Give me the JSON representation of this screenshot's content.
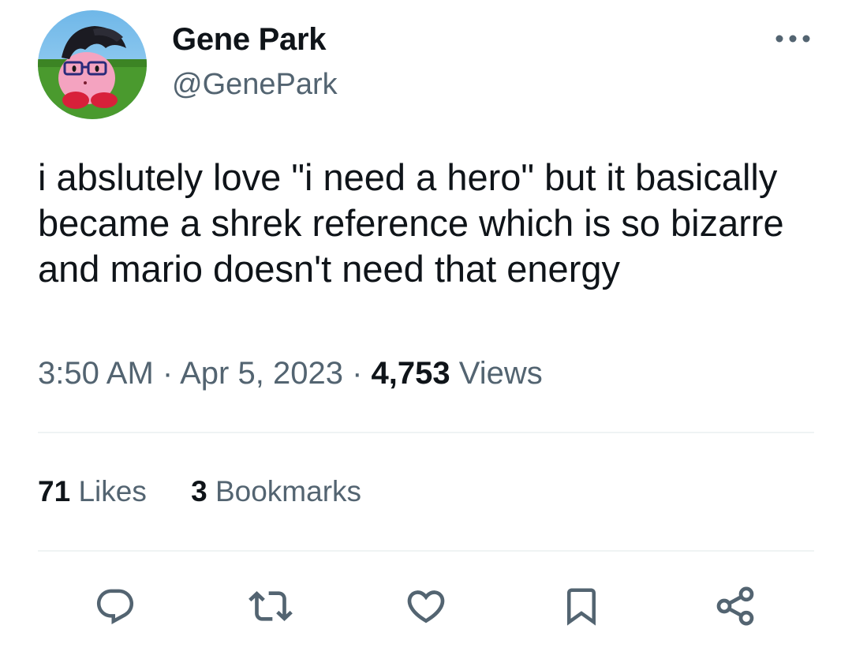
{
  "author": {
    "name": "Gene Park",
    "handle": "@GenePark",
    "avatar_icon": "avatar-image"
  },
  "tweet": {
    "text": "i abslutely love \"i need a hero\" but it basically\nbecame a shrek reference which is so bizarre\nand mario doesn't need that energy",
    "time": "3:50 AM",
    "separator": "·",
    "date": "Apr 5, 2023",
    "views_count": "4,753",
    "views_label": "Views"
  },
  "stats": {
    "likes_count": "71",
    "likes_label": "Likes",
    "bookmarks_count": "3",
    "bookmarks_label": "Bookmarks"
  },
  "actions": {
    "reply_icon": "reply-icon",
    "retweet_icon": "retweet-icon",
    "like_icon": "heart-icon",
    "bookmark_icon": "bookmark-icon",
    "share_icon": "share-icon",
    "more_icon": "more-options-icon"
  },
  "colors": {
    "text_primary": "#0f1419",
    "text_secondary": "#536471",
    "divider": "#eff3f4",
    "icon": "#536471"
  }
}
